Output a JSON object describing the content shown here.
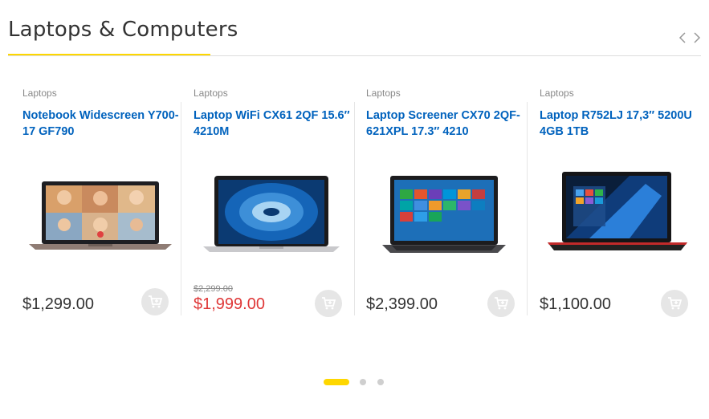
{
  "section": {
    "title": "Laptops & Computers"
  },
  "colors": {
    "accent": "#fed700",
    "link": "#0062bd",
    "sale": "#df3737"
  },
  "products": [
    {
      "category": "Laptops",
      "name": "Notebook Widescreen Y700-17 GF790",
      "price": "$1,299.00",
      "old_price": null,
      "image": "laptop-video-call"
    },
    {
      "category": "Laptops",
      "name": "Laptop WiFi CX61 2QF 15.6″ 4210M",
      "price": "$1,999.00",
      "old_price": "$2,299.00",
      "image": "laptop-wave"
    },
    {
      "category": "Laptops",
      "name": "Laptop Screener CX70 2QF-621XPL 17.3″ 4210",
      "price": "$2,399.00",
      "old_price": null,
      "image": "laptop-tiles"
    },
    {
      "category": "Laptops",
      "name": "Laptop R752LJ 17,3″ 5200U 4GB 1TB",
      "price": "$1,100.00",
      "old_price": null,
      "image": "laptop-windows10"
    }
  ],
  "icons": {
    "prev": "chevron-left-icon",
    "next": "chevron-right-icon",
    "cart": "add-to-cart-icon"
  },
  "pagination": {
    "pages": 3,
    "current": 1
  }
}
